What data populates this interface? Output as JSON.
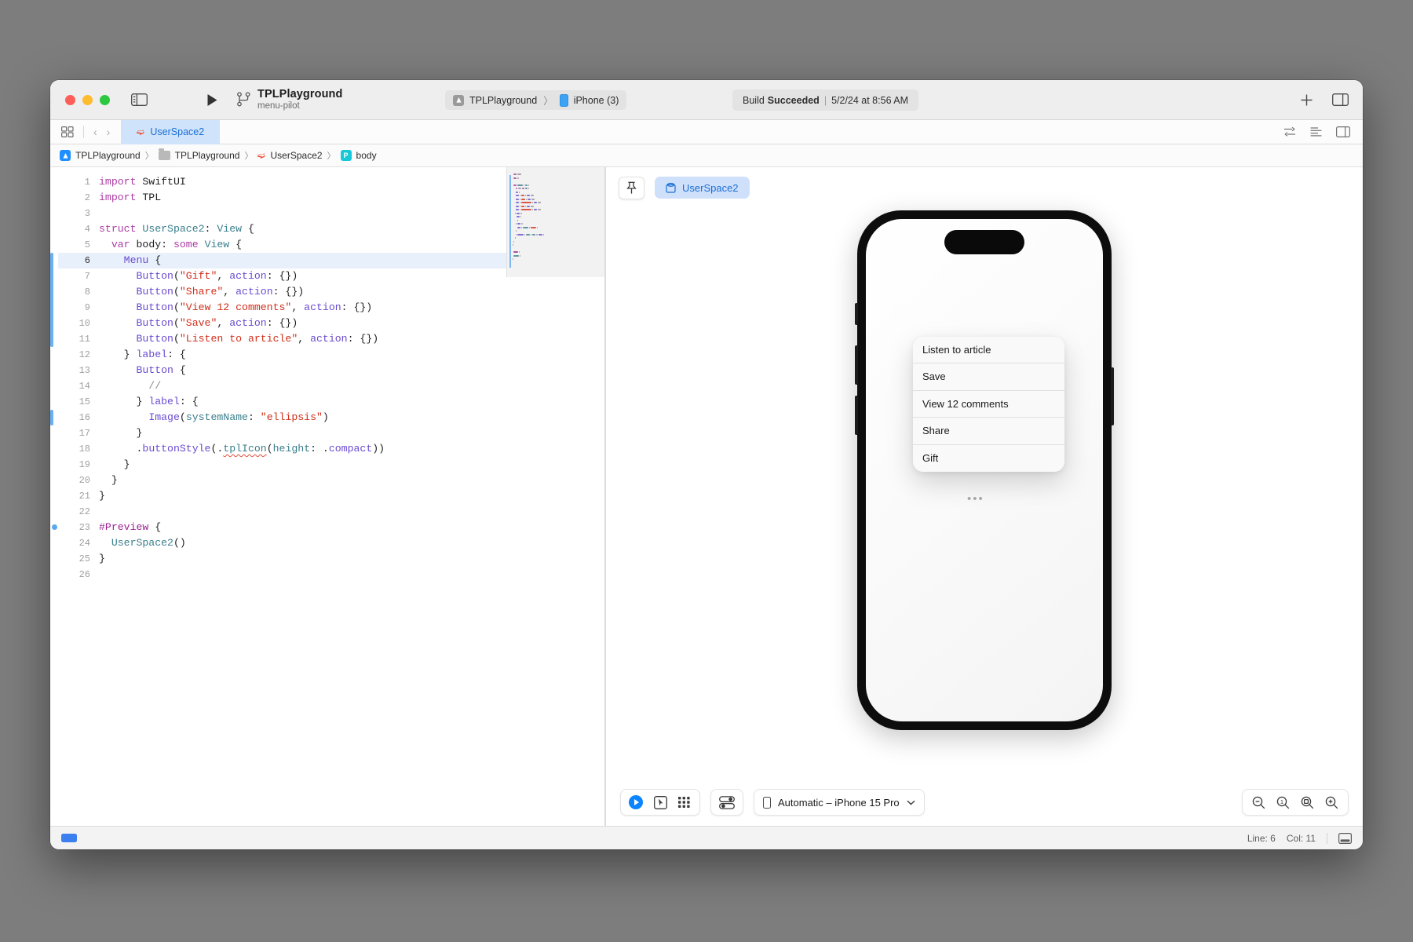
{
  "window": {
    "traffic_lights": [
      "close",
      "minimize",
      "zoom"
    ],
    "colors": {
      "accent_blue": "#1b6fd4",
      "tab_active_bg": "#cfe3fb",
      "swift_orange": "#f05138",
      "play_blue": "#0a84ff",
      "string_red": "#d12f1b",
      "keyword_magenta": "#ad3da4",
      "type_teal": "#3a7f8c",
      "func_purple": "#6a4bd1",
      "comment_gray": "#8c8c8c"
    }
  },
  "toolbar": {
    "sidebar_toggle": "sidebar-toggle-icon",
    "run_button": "run-icon",
    "scheme_name": "TPLPlayground",
    "branch_name": "menu-pilot",
    "destination": {
      "scheme": "TPLPlayground",
      "separator": "〉",
      "device": "iPhone (3)"
    },
    "build_status": {
      "prefix": "Build",
      "result": "Succeeded",
      "separator": "|",
      "timestamp": "5/2/24 at 8:56 AM"
    },
    "add_button": "plus-icon",
    "inspector_toggle": "inspector-toggle-icon"
  },
  "tabbar": {
    "grid_icon": "tab-grid-icon",
    "back": "‹",
    "forward": "›",
    "open_tab": {
      "icon": "swift-file-icon",
      "label": "UserSpace2"
    },
    "right_icons": [
      "adjust-editor-icon",
      "editor-options-icon",
      "split-editor-icon"
    ]
  },
  "breadcrumb": {
    "items": [
      {
        "label": "TPLPlayground",
        "icon": "app-badge-icon"
      },
      {
        "label": "TPLPlayground",
        "icon": "folder-icon"
      },
      {
        "label": "UserSpace2",
        "icon": "swift-file-icon"
      },
      {
        "label": "body",
        "icon": "preview-badge-icon"
      }
    ],
    "separator": "〉"
  },
  "editor": {
    "highlighted_line": 6,
    "total_lines": 26,
    "lines": [
      {
        "n": 1,
        "tokens": [
          {
            "t": "import",
            "c": "k-kw"
          },
          {
            "t": " SwiftUI",
            "c": "k-pun"
          }
        ]
      },
      {
        "n": 2,
        "tokens": [
          {
            "t": "import",
            "c": "k-kw"
          },
          {
            "t": " TPL",
            "c": "k-pun"
          }
        ]
      },
      {
        "n": 3,
        "tokens": []
      },
      {
        "n": 4,
        "tokens": [
          {
            "t": "struct",
            "c": "k-kw"
          },
          {
            "t": " ",
            "c": "k-pun"
          },
          {
            "t": "UserSpace2",
            "c": "k-type"
          },
          {
            "t": ": ",
            "c": "k-pun"
          },
          {
            "t": "View",
            "c": "k-type"
          },
          {
            "t": " {",
            "c": "k-pun"
          }
        ]
      },
      {
        "n": 5,
        "tokens": [
          {
            "t": "  ",
            "c": "k-pun"
          },
          {
            "t": "var",
            "c": "k-kw"
          },
          {
            "t": " body: ",
            "c": "k-pun"
          },
          {
            "t": "some",
            "c": "k-kw"
          },
          {
            "t": " ",
            "c": "k-pun"
          },
          {
            "t": "View",
            "c": "k-type"
          },
          {
            "t": " {",
            "c": "k-pun"
          }
        ]
      },
      {
        "n": 6,
        "tokens": [
          {
            "t": "    ",
            "c": "k-pun"
          },
          {
            "t": "Menu",
            "c": "k-fn"
          },
          {
            "t": " {",
            "c": "k-pun"
          }
        ]
      },
      {
        "n": 7,
        "tokens": [
          {
            "t": "      ",
            "c": "k-pun"
          },
          {
            "t": "Button",
            "c": "k-fn"
          },
          {
            "t": "(",
            "c": "k-pun"
          },
          {
            "t": "\"Gift\"",
            "c": "k-str"
          },
          {
            "t": ", ",
            "c": "k-pun"
          },
          {
            "t": "action",
            "c": "k-fn"
          },
          {
            "t": ": {})",
            "c": "k-pun"
          }
        ]
      },
      {
        "n": 8,
        "tokens": [
          {
            "t": "      ",
            "c": "k-pun"
          },
          {
            "t": "Button",
            "c": "k-fn"
          },
          {
            "t": "(",
            "c": "k-pun"
          },
          {
            "t": "\"Share\"",
            "c": "k-str"
          },
          {
            "t": ", ",
            "c": "k-pun"
          },
          {
            "t": "action",
            "c": "k-fn"
          },
          {
            "t": ": {})",
            "c": "k-pun"
          }
        ]
      },
      {
        "n": 9,
        "tokens": [
          {
            "t": "      ",
            "c": "k-pun"
          },
          {
            "t": "Button",
            "c": "k-fn"
          },
          {
            "t": "(",
            "c": "k-pun"
          },
          {
            "t": "\"View 12 comments\"",
            "c": "k-str"
          },
          {
            "t": ", ",
            "c": "k-pun"
          },
          {
            "t": "action",
            "c": "k-fn"
          },
          {
            "t": ": {})",
            "c": "k-pun"
          }
        ]
      },
      {
        "n": 10,
        "tokens": [
          {
            "t": "      ",
            "c": "k-pun"
          },
          {
            "t": "Button",
            "c": "k-fn"
          },
          {
            "t": "(",
            "c": "k-pun"
          },
          {
            "t": "\"Save\"",
            "c": "k-str"
          },
          {
            "t": ", ",
            "c": "k-pun"
          },
          {
            "t": "action",
            "c": "k-fn"
          },
          {
            "t": ": {})",
            "c": "k-pun"
          }
        ]
      },
      {
        "n": 11,
        "tokens": [
          {
            "t": "      ",
            "c": "k-pun"
          },
          {
            "t": "Button",
            "c": "k-fn"
          },
          {
            "t": "(",
            "c": "k-pun"
          },
          {
            "t": "\"Listen to article\"",
            "c": "k-str"
          },
          {
            "t": ", ",
            "c": "k-pun"
          },
          {
            "t": "action",
            "c": "k-fn"
          },
          {
            "t": ": {})",
            "c": "k-pun"
          }
        ]
      },
      {
        "n": 12,
        "tokens": [
          {
            "t": "    } ",
            "c": "k-pun"
          },
          {
            "t": "label",
            "c": "k-fn"
          },
          {
            "t": ": {",
            "c": "k-pun"
          }
        ]
      },
      {
        "n": 13,
        "tokens": [
          {
            "t": "      ",
            "c": "k-pun"
          },
          {
            "t": "Button",
            "c": "k-fn"
          },
          {
            "t": " {",
            "c": "k-pun"
          }
        ]
      },
      {
        "n": 14,
        "tokens": [
          {
            "t": "        //",
            "c": "k-cmt"
          }
        ]
      },
      {
        "n": 15,
        "tokens": [
          {
            "t": "      } ",
            "c": "k-pun"
          },
          {
            "t": "label",
            "c": "k-fn"
          },
          {
            "t": ": {",
            "c": "k-pun"
          }
        ]
      },
      {
        "n": 16,
        "tokens": [
          {
            "t": "        ",
            "c": "k-pun"
          },
          {
            "t": "Image",
            "c": "k-fn"
          },
          {
            "t": "(",
            "c": "k-pun"
          },
          {
            "t": "systemName",
            "c": "k-param"
          },
          {
            "t": ": ",
            "c": "k-pun"
          },
          {
            "t": "\"ellipsis\"",
            "c": "k-str"
          },
          {
            "t": ")",
            "c": "k-pun"
          }
        ]
      },
      {
        "n": 17,
        "tokens": [
          {
            "t": "      }",
            "c": "k-pun"
          }
        ]
      },
      {
        "n": 18,
        "tokens": [
          {
            "t": "      .",
            "c": "k-pun"
          },
          {
            "t": "buttonStyle",
            "c": "k-fn"
          },
          {
            "t": "(.",
            "c": "k-pun"
          },
          {
            "t": "tplIcon",
            "c": "k-type squig"
          },
          {
            "t": "(",
            "c": "k-pun"
          },
          {
            "t": "height",
            "c": "k-param"
          },
          {
            "t": ": .",
            "c": "k-pun"
          },
          {
            "t": "compact",
            "c": "k-fn"
          },
          {
            "t": "))",
            "c": "k-pun"
          }
        ]
      },
      {
        "n": 19,
        "tokens": [
          {
            "t": "    }",
            "c": "k-pun"
          }
        ]
      },
      {
        "n": 20,
        "tokens": [
          {
            "t": "  }",
            "c": "k-pun"
          }
        ]
      },
      {
        "n": 21,
        "tokens": [
          {
            "t": "}",
            "c": "k-pun"
          }
        ]
      },
      {
        "n": 22,
        "tokens": []
      },
      {
        "n": 23,
        "tokens": [
          {
            "t": "#Preview",
            "c": "k-kw2"
          },
          {
            "t": " {",
            "c": "k-pun"
          }
        ]
      },
      {
        "n": 24,
        "tokens": [
          {
            "t": "  ",
            "c": "k-pun"
          },
          {
            "t": "UserSpace2",
            "c": "k-type"
          },
          {
            "t": "()",
            "c": "k-pun"
          }
        ]
      },
      {
        "n": 25,
        "tokens": [
          {
            "t": "}",
            "c": "k-pun"
          }
        ]
      },
      {
        "n": 26,
        "tokens": []
      }
    ]
  },
  "canvas": {
    "pin_button": "pin-icon",
    "preview_chip": {
      "icon": "preview-cube-icon",
      "label": "UserSpace2"
    },
    "phone": {
      "menu_items": [
        "Listen to article",
        "Save",
        "View 12 comments",
        "Share",
        "Gift"
      ],
      "ellipsis_label": "•••"
    },
    "bottom_bar": {
      "live_mode": "live-preview-icon",
      "select_mode": "selection-cursor-icon",
      "variants_mode": "variants-grid-icon",
      "settings": "preview-settings-icon",
      "device_picker": "Automatic – iPhone 15 Pro",
      "device_picker_chevron": "⌄",
      "zoom_controls": [
        "zoom-out-icon",
        "zoom-actual-size-icon",
        "zoom-to-fit-icon",
        "zoom-in-icon"
      ]
    }
  },
  "statusbar": {
    "line_label": "Line: 6",
    "col_label": "Col: 11",
    "layout_icon": "editor-layout-icon"
  }
}
